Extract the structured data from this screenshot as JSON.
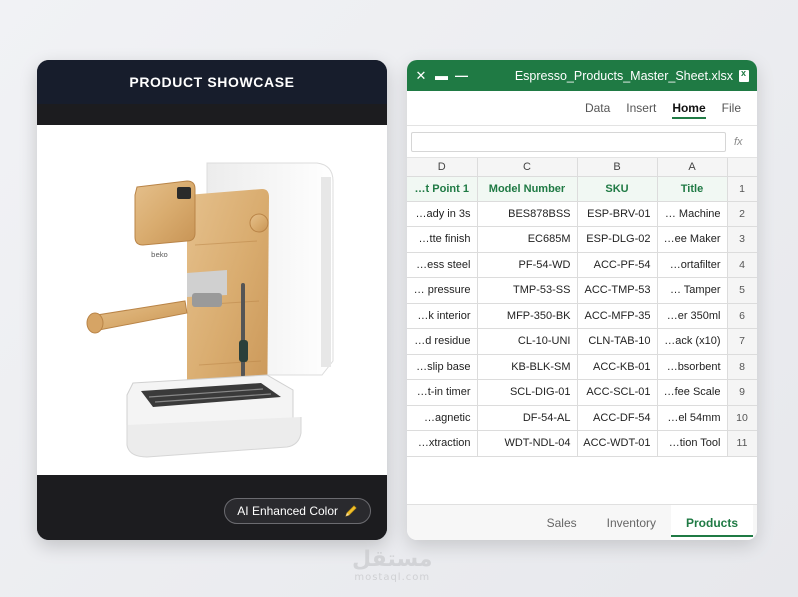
{
  "showcase": {
    "title": "PRODUCT SHOWCASE",
    "badge_label": "AI Enhanced Color",
    "badge_icon": "pencil-icon"
  },
  "sheet": {
    "filename": "Espresso_Products_Master_Sheet.xlsx",
    "ribbon_tabs": [
      "Data",
      "Insert",
      "Home",
      "File"
    ],
    "active_ribbon_tab": "Home",
    "formula_value": "",
    "fx_label": "fx",
    "column_letters": [
      "D",
      "C",
      "B",
      "A",
      ""
    ],
    "header_row": {
      "row_number": "1",
      "cells": [
        "…t Point 1",
        "Model Number",
        "SKU",
        "Title"
      ]
    },
    "rows": [
      {
        "n": "2",
        "d": "…ady in 3s",
        "c": "BES878BSS",
        "b": "ESP-BRV-01",
        "a": "… Machine"
      },
      {
        "n": "3",
        "d": "…tte finish",
        "c": "EC685M",
        "b": "ESP-DLG-02",
        "a": "…ee Maker"
      },
      {
        "n": "4",
        "d": "…ess steel",
        "c": "PF-54-WD",
        "b": "ACC-PF-54",
        "a": "…ortafilter"
      },
      {
        "n": "5",
        "d": "… pressure",
        "c": "TMP-53-SS",
        "b": "ACC-TMP-53",
        "a": "… Tamper"
      },
      {
        "n": "6",
        "d": "…k interior",
        "c": "MFP-350-BK",
        "b": "ACC-MFP-35",
        "a": "…er 350ml"
      },
      {
        "n": "7",
        "d": "…d residue",
        "c": "CL-10-UNI",
        "b": "CLN-TAB-10",
        "a": "…ack (x10)"
      },
      {
        "n": "8",
        "d": "…slip base",
        "c": "KB-BLK-SM",
        "b": "ACC-KB-01",
        "a": "…bsorbent"
      },
      {
        "n": "9",
        "d": "…t-in timer",
        "c": "SCL-DIG-01",
        "b": "ACC-SCL-01",
        "a": "…fee Scale"
      },
      {
        "n": "10",
        "d": "…agnetic",
        "c": "DF-54-AL",
        "b": "ACC-DF-54",
        "a": "…el 54mm"
      },
      {
        "n": "11",
        "d": "…xtraction",
        "c": "WDT-NDL-04",
        "b": "ACC-WDT-01",
        "a": "…tion Tool"
      }
    ],
    "sheet_tabs": [
      "Sales",
      "Inventory",
      "Products"
    ],
    "active_sheet_tab": "Products"
  },
  "watermark": {
    "arabic": "مستقل",
    "latin": "mostaql.com"
  },
  "colors": {
    "excel_green": "#1f7a44",
    "card_dark": "#1c1c1f",
    "card_header": "#171d2c"
  }
}
